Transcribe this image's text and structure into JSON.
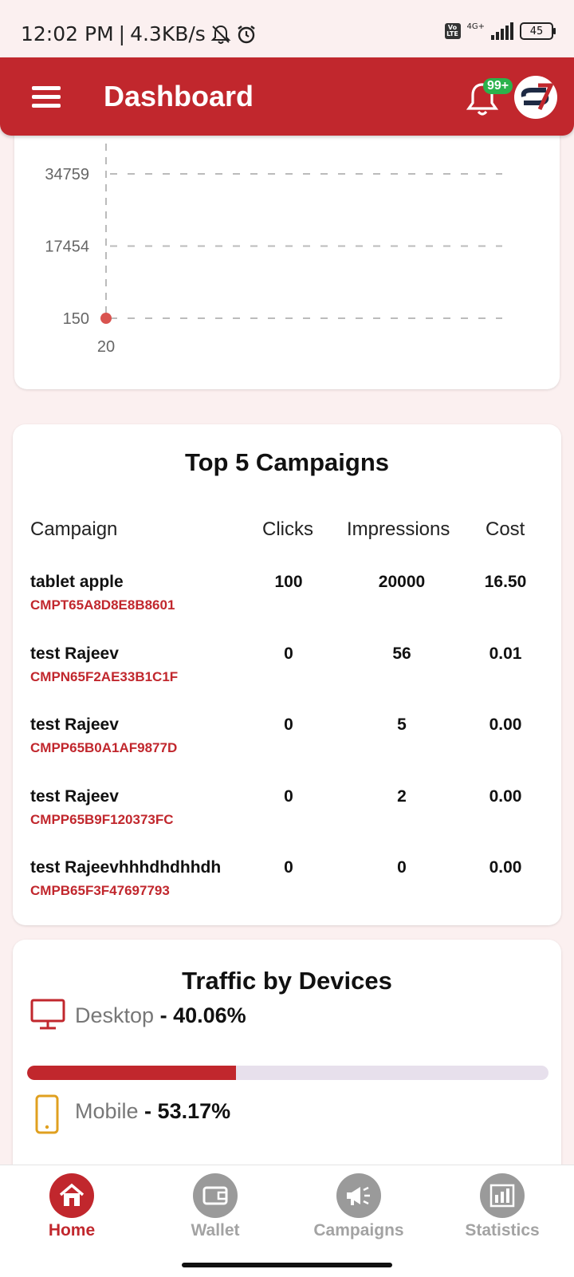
{
  "status_bar": {
    "time": "12:02 PM",
    "speed": "4.3KB/s",
    "network": "4G+",
    "volte": "Vo LTE",
    "battery": "45",
    "icons": [
      "mute-bell-icon",
      "alarm-icon",
      "signal-icon",
      "battery-icon"
    ]
  },
  "header": {
    "title": "Dashboard",
    "notification_badge": "99+",
    "icons": [
      "menu-icon",
      "bell-icon",
      "avatar-logo-icon"
    ],
    "colors": {
      "primary": "#c1272d",
      "badge": "#2bb24c"
    }
  },
  "chart_data": {
    "type": "scatter",
    "y_ticks": [
      "34759",
      "17454",
      "150"
    ],
    "x_ticks": [
      "20"
    ],
    "points": [
      {
        "x": 20,
        "y": 150
      }
    ],
    "ylim": [
      150,
      34759
    ],
    "grid": true,
    "point_color": "#d9534f"
  },
  "campaigns": {
    "title": "Top 5 Campaigns",
    "columns": [
      "Campaign",
      "Clicks",
      "Impressions",
      "Cost"
    ],
    "rows": [
      {
        "name": "tablet apple",
        "id": "CMPT65A8D8E8B8601",
        "clicks": "100",
        "impressions": "20000",
        "cost": "16.50"
      },
      {
        "name": "test Rajeev",
        "id": "CMPN65F2AE33B1C1F",
        "clicks": "0",
        "impressions": "56",
        "cost": "0.01"
      },
      {
        "name": "test Rajeev",
        "id": "CMPP65B0A1AF9877D",
        "clicks": "0",
        "impressions": "5",
        "cost": "0.00"
      },
      {
        "name": "test Rajeev",
        "id": "CMPP65B9F120373FC",
        "clicks": "0",
        "impressions": "2",
        "cost": "0.00"
      },
      {
        "name": "test Rajeevhhhdhdhhdh",
        "id": "CMPB65F3F47697793",
        "clicks": "0",
        "impressions": "0",
        "cost": "0.00"
      }
    ]
  },
  "devices": {
    "title": "Traffic by Devices",
    "items": [
      {
        "label": "Desktop",
        "value": "40.06%",
        "fraction": 0.4006,
        "icon": "desktop-icon"
      },
      {
        "label": "Mobile",
        "value": "53.17%",
        "fraction": 0.5317,
        "icon": "mobile-icon"
      }
    ],
    "separator": " - "
  },
  "nav": {
    "items": [
      {
        "label": "Home",
        "icon": "home-icon",
        "active": true
      },
      {
        "label": "Wallet",
        "icon": "wallet-icon",
        "active": false
      },
      {
        "label": "Campaigns",
        "icon": "megaphone-icon",
        "active": false
      },
      {
        "label": "Statistics",
        "icon": "bar-chart-icon",
        "active": false
      }
    ]
  }
}
